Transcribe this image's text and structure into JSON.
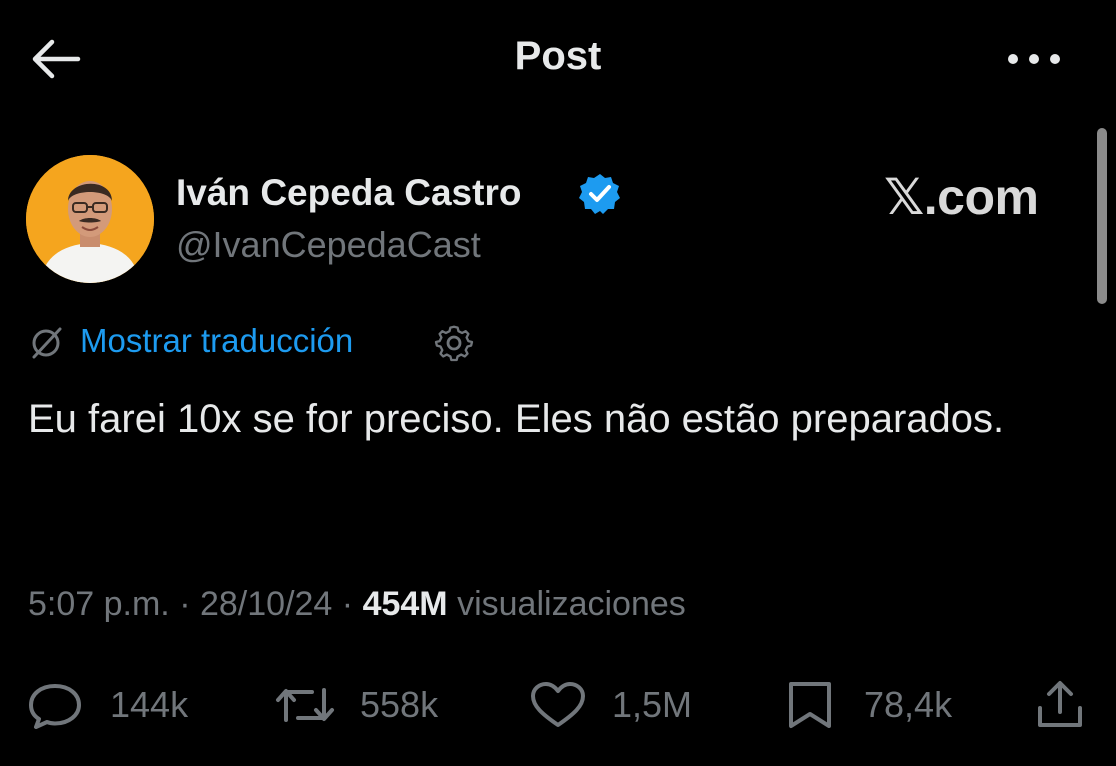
{
  "header": {
    "title": "Post",
    "back_icon": "arrow-left-icon",
    "more_icon": "more-horizontal-icon"
  },
  "author": {
    "name": "Iván Cepeda Castro",
    "handle": "@IvanCepedaCast",
    "verified": true,
    "verified_color": "#1d9bf0",
    "avatar_bg": "#f5a51e"
  },
  "watermark": "𝕏.com",
  "translate": {
    "label": "Mostrar traducción",
    "icon": "translate-off-icon",
    "settings_icon": "gear-icon"
  },
  "post": {
    "text": "Eu farei 10x se for preciso. Eles não estão preparados."
  },
  "meta": {
    "time": "5:07 p.m.",
    "date": "28/10/24",
    "views_count": "454M",
    "views_label": "visualizaciones",
    "separator": "·"
  },
  "actions": {
    "replies": "144k",
    "reposts": "558k",
    "likes": "1,5M",
    "bookmarks": "78,4k"
  },
  "colors": {
    "background": "#000000",
    "text": "#e7e9ea",
    "secondary": "#71767b",
    "link": "#1d9bf0"
  }
}
